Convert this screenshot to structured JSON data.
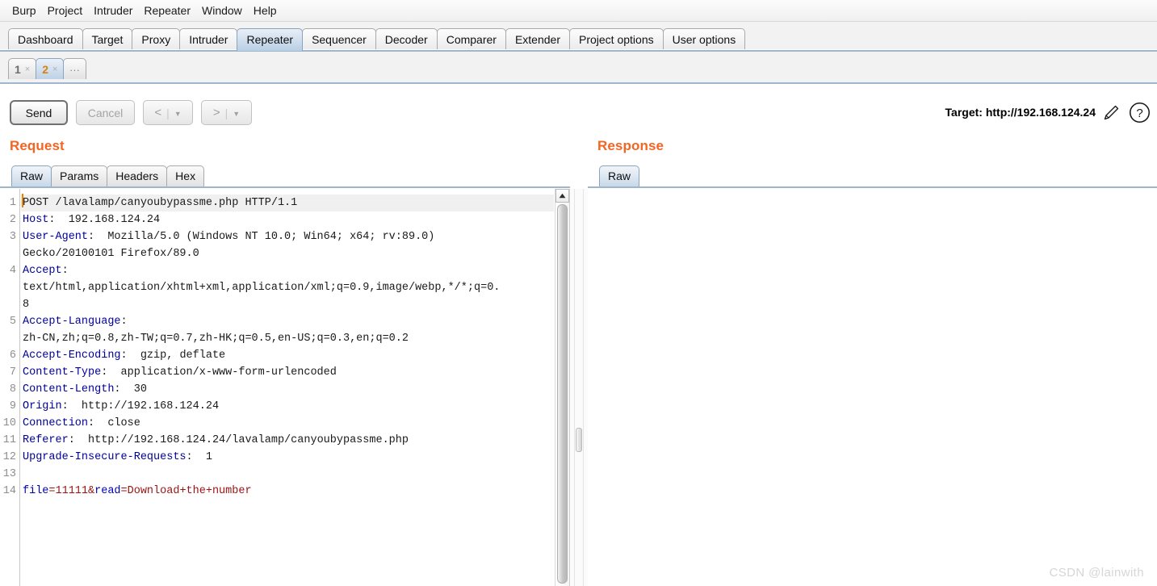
{
  "menubar": {
    "items": [
      {
        "label": "Burp"
      },
      {
        "label": "Project"
      },
      {
        "label": "Intruder"
      },
      {
        "label": "Repeater"
      },
      {
        "label": "Window"
      },
      {
        "label": "Help"
      }
    ]
  },
  "main_tabs": {
    "items": [
      {
        "label": "Dashboard",
        "active": false
      },
      {
        "label": "Target",
        "active": false
      },
      {
        "label": "Proxy",
        "active": false
      },
      {
        "label": "Intruder",
        "active": false
      },
      {
        "label": "Repeater",
        "active": true
      },
      {
        "label": "Sequencer",
        "active": false
      },
      {
        "label": "Decoder",
        "active": false
      },
      {
        "label": "Comparer",
        "active": false
      },
      {
        "label": "Extender",
        "active": false
      },
      {
        "label": "Project options",
        "active": false
      },
      {
        "label": "User options",
        "active": false
      }
    ]
  },
  "repeater_tabs": {
    "items": [
      {
        "label": "1",
        "close": "×",
        "active": false
      },
      {
        "label": "2",
        "close": "×",
        "active": true
      }
    ],
    "new_tab_label": "..."
  },
  "toolbar": {
    "send_label": "Send",
    "cancel_label": "Cancel",
    "back_arrow": "<",
    "forward_arrow": ">",
    "separator": "|",
    "caret": "▼",
    "target_label": "Target: http://192.168.124.24",
    "edit_icon_name": "pencil-icon",
    "help_icon_name": "question-mark-icon"
  },
  "request_panel": {
    "title": "Request",
    "tabs": [
      {
        "label": "Raw",
        "active": true
      },
      {
        "label": "Params",
        "active": false
      },
      {
        "label": "Headers",
        "active": false
      },
      {
        "label": "Hex",
        "active": false
      }
    ],
    "lines": [
      {
        "num": "1",
        "segments": [
          {
            "text": "POST /lavalamp/canyoubypassme.php HTTP/1.1",
            "style": "val"
          }
        ],
        "highlight": true
      },
      {
        "num": "2",
        "segments": [
          {
            "text": "Host",
            "style": "hdr"
          },
          {
            "text": ":  192.168.124.24",
            "style": "val"
          }
        ]
      },
      {
        "num": "3",
        "segments": [
          {
            "text": "User-Agent",
            "style": "hdr"
          },
          {
            "text": ":  Mozilla/5.0 (Windows NT 10.0; Win64; x64; rv:89.0)",
            "style": "val"
          }
        ]
      },
      {
        "num": "",
        "segments": [
          {
            "text": "Gecko/20100101 Firefox/89.0",
            "style": "val"
          }
        ]
      },
      {
        "num": "4",
        "segments": [
          {
            "text": "Accept",
            "style": "hdr"
          },
          {
            "text": ":",
            "style": "val"
          }
        ]
      },
      {
        "num": "",
        "segments": [
          {
            "text": "text/html,application/xhtml+xml,application/xml;q=0.9,image/webp,*/*;q=0.",
            "style": "val"
          }
        ]
      },
      {
        "num": "",
        "segments": [
          {
            "text": "8",
            "style": "val"
          }
        ]
      },
      {
        "num": "5",
        "segments": [
          {
            "text": "Accept-Language",
            "style": "hdr"
          },
          {
            "text": ":",
            "style": "val"
          }
        ]
      },
      {
        "num": "",
        "segments": [
          {
            "text": "zh-CN,zh;q=0.8,zh-TW;q=0.7,zh-HK;q=0.5,en-US;q=0.3,en;q=0.2",
            "style": "val"
          }
        ]
      },
      {
        "num": "6",
        "segments": [
          {
            "text": "Accept-Encoding",
            "style": "hdr"
          },
          {
            "text": ":  gzip, deflate",
            "style": "val"
          }
        ]
      },
      {
        "num": "7",
        "segments": [
          {
            "text": "Content-Type",
            "style": "hdr"
          },
          {
            "text": ":  application/x-www-form-urlencoded",
            "style": "val"
          }
        ]
      },
      {
        "num": "8",
        "segments": [
          {
            "text": "Content-Length",
            "style": "hdr"
          },
          {
            "text": ":  30",
            "style": "val"
          }
        ]
      },
      {
        "num": "9",
        "segments": [
          {
            "text": "Origin",
            "style": "hdr"
          },
          {
            "text": ":  http://192.168.124.24",
            "style": "val"
          }
        ]
      },
      {
        "num": "10",
        "segments": [
          {
            "text": "Connection",
            "style": "hdr"
          },
          {
            "text": ":  close",
            "style": "val"
          }
        ]
      },
      {
        "num": "11",
        "segments": [
          {
            "text": "Referer",
            "style": "hdr"
          },
          {
            "text": ":  http://192.168.124.24/lavalamp/canyoubypassme.php",
            "style": "val"
          }
        ]
      },
      {
        "num": "12",
        "segments": [
          {
            "text": "Upgrade-Insecure-Requests",
            "style": "hdr"
          },
          {
            "text": ":  1",
            "style": "val"
          }
        ]
      },
      {
        "num": "13",
        "segments": [
          {
            "text": "",
            "style": "val"
          }
        ]
      },
      {
        "num": "14",
        "segments": [
          {
            "text": "file",
            "style": "pname"
          },
          {
            "text": "=11111&",
            "style": "pval"
          },
          {
            "text": "read",
            "style": "pname"
          },
          {
            "text": "=Download+the+number",
            "style": "pval"
          }
        ]
      }
    ]
  },
  "response_panel": {
    "title": "Response",
    "tabs": [
      {
        "label": "Raw",
        "active": true
      }
    ],
    "body": ""
  },
  "watermark": "CSDN @lainwith",
  "colors": {
    "accent_orange": "#f26522",
    "header_blue": "#00009a",
    "param_value_red": "#9b1212",
    "caret_orange": "#f08000",
    "tab_active_blue": "#bdd1e6"
  }
}
